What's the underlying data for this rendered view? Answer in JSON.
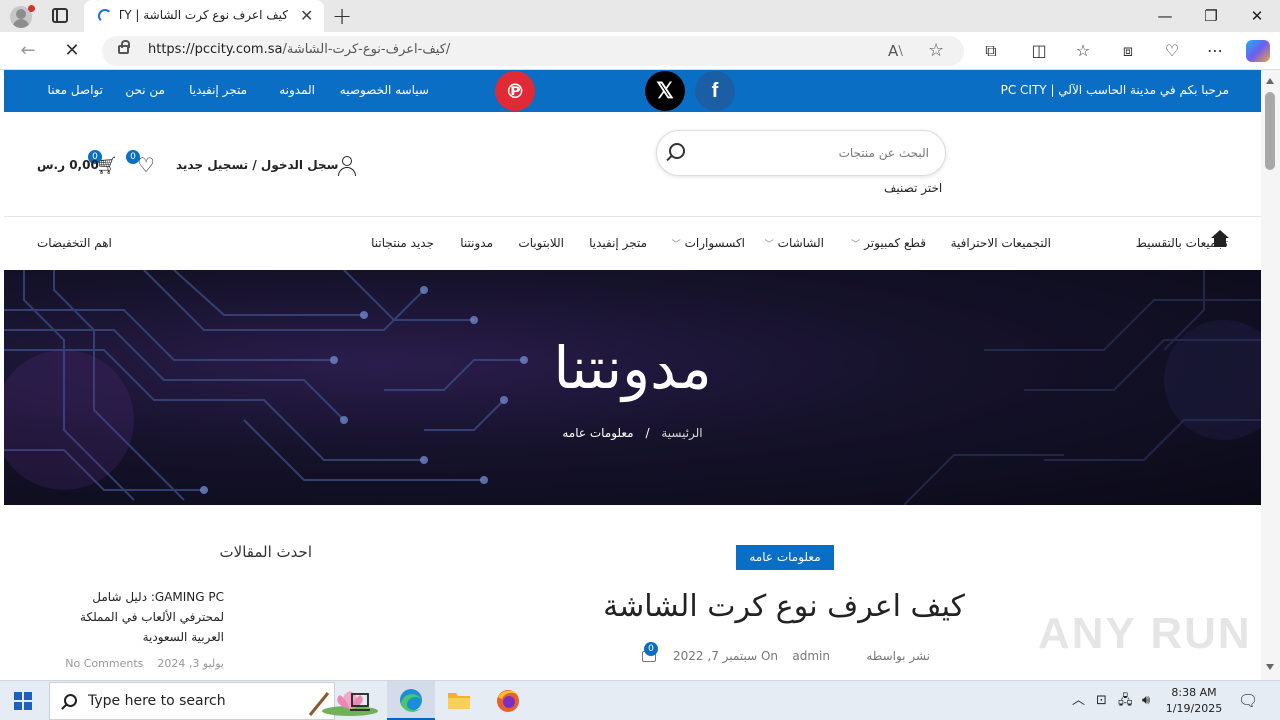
{
  "browser": {
    "tab_title": "كيف اعرف نوع كرت الشاشة | PC CITY",
    "tab_close": "✕",
    "new_tab": "+",
    "url_host": "https://pccity.com.sa",
    "url_path": "/كيف-اعرف-نوع-كرت-الشاشة/",
    "win_minimize": "—",
    "win_restore": "❐",
    "win_close": "✕",
    "back": "←",
    "reload": "✕"
  },
  "topbar": {
    "welcome": "مرحبا بكم في مدينة الحاسب الآلي | PC CITY",
    "facebook": "f",
    "x": "𝕏",
    "pinterest": "℗",
    "links": [
      "سياسه الخصوصيه",
      "المدونه",
      "متجر إنفيديا",
      "من نحن",
      "تواصل معنا"
    ]
  },
  "header": {
    "search_placeholder": "البحث عن منتجات",
    "category_select": "اختر تصنيف",
    "login": "سجل الدخول / تسجيل جديد",
    "wishlist_count": "0",
    "cart_count": "0",
    "cart_total": "0,00 ر.س"
  },
  "menu": {
    "items": [
      "تجميعات بالتقسيط",
      "التجميعات الاحترافية",
      "قطع كمبيوتر",
      "الشاشات",
      "اكسسوارات",
      "متجر إنفيديا",
      "اللابتوبات",
      "مدونتنا",
      "جديد منتجاتنا"
    ],
    "deals": "اهم التخفيضات"
  },
  "hero": {
    "title": "مدونتنا",
    "crumb_home": "الرئيسية",
    "crumb_sep": "/",
    "crumb_current": "معلومات عامه"
  },
  "post": {
    "category": "معلومات عامه",
    "title": "كيف اعرف نوع كرت الشاشة",
    "posted_by": "نشر بواسطه",
    "author": "admin",
    "date": "On سبتمبر 7, 2022",
    "comments": "0"
  },
  "sidebar": {
    "title": "احدث المقالات",
    "post_title": "GAMING PC: دليل شامل لمحترفي الألعاب في المملكة العربية السعودية",
    "post_date": "يوليو 3, 2024",
    "post_comments": "No Comments"
  },
  "watermark": "ANY RUN",
  "taskbar": {
    "search_placeholder": "Type here to search",
    "time": "8:38 AM",
    "date": "1/19/2025"
  },
  "colors": {
    "brand_blue": "#0a6ec5",
    "facebook": "#1c5ea6",
    "pinterest": "#e02a35"
  }
}
